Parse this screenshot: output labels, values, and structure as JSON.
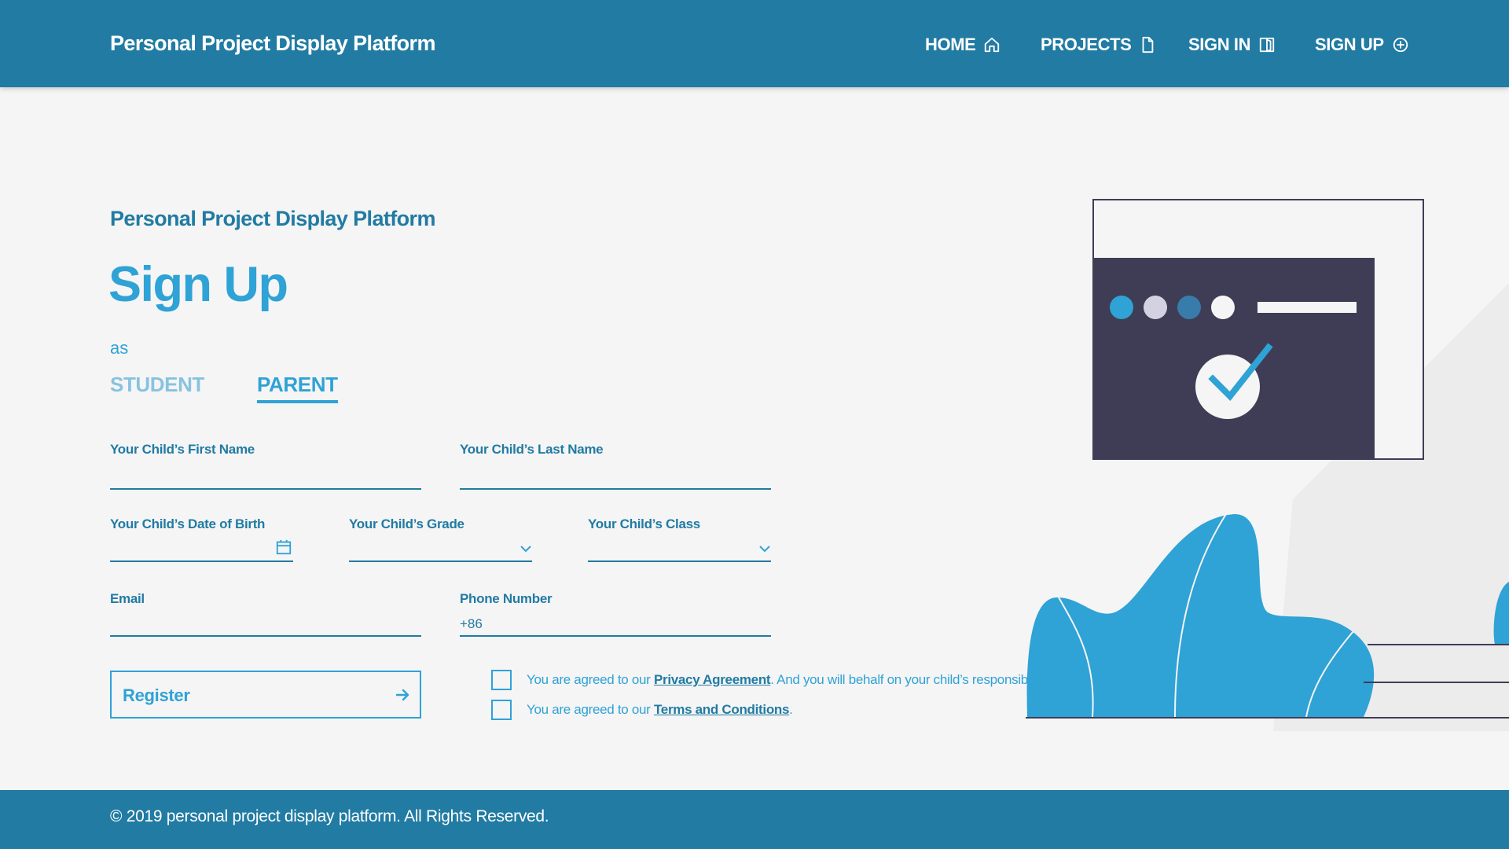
{
  "header": {
    "brand": "Personal Project Display Platform",
    "nav": [
      {
        "label": "HOME",
        "icon": "home-icon"
      },
      {
        "label": "PROJECTS",
        "icon": "document-icon"
      },
      {
        "label": "SIGN IN",
        "icon": "sign-in-icon"
      },
      {
        "label": "SIGN UP",
        "icon": "plus-circle-icon"
      }
    ]
  },
  "main": {
    "subtitle": "Personal Project Display Platform",
    "title": "Sign Up",
    "as_text": "as",
    "roles": [
      {
        "label": "STUDENT",
        "active": false
      },
      {
        "label": "PARENT",
        "active": true
      }
    ],
    "fields": {
      "first_name": {
        "label": "Your Child’s First Name",
        "value": ""
      },
      "last_name": {
        "label": "Your Child’s Last Name",
        "value": ""
      },
      "dob": {
        "label": "Your Child’s Date of Birth",
        "value": "",
        "icon": "calendar-icon"
      },
      "grade": {
        "label": "Your Child’s Grade",
        "value": "",
        "icon": "chevron-down-icon"
      },
      "class": {
        "label": "Your Child’s Class",
        "value": "",
        "icon": "chevron-down-icon"
      },
      "email": {
        "label": "Email",
        "value": ""
      },
      "phone": {
        "label": "Phone Number",
        "prefix": "+86",
        "value": ""
      }
    },
    "register": {
      "label": "Register",
      "icon": "arrow-right-icon"
    },
    "agreements": [
      {
        "before": "You are agreed to our ",
        "link": "Privacy Agreement",
        "after": ". And you will behalf on your child’s responsibility.",
        "checked": false
      },
      {
        "before": "You are agreed to our ",
        "link": "Terms and Conditions",
        "after": ".",
        "checked": false
      }
    ]
  },
  "footer": {
    "copyright": "© 2019 personal project display platform. All Rights Reserved."
  },
  "colors": {
    "primary": "#217ba3",
    "accent": "#2fa2d6",
    "background": "#f5f5f5",
    "illustration_dark": "#3f3d56"
  }
}
